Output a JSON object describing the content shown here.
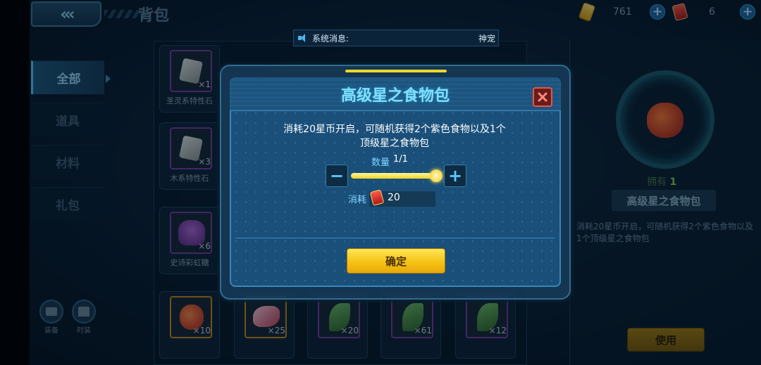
{
  "header": {
    "back_icon": "double-chevron-left",
    "title": "背包",
    "coins": "761",
    "gems": "6"
  },
  "sidebar": {
    "items": [
      {
        "label": "全部",
        "active": true
      },
      {
        "label": "道具",
        "active": false
      },
      {
        "label": "材料",
        "active": false
      },
      {
        "label": "礼包",
        "active": false
      }
    ],
    "equip_label": "装备",
    "fashion_label": "时装"
  },
  "system_message": {
    "label": "系统消息:",
    "text": "神宠"
  },
  "inventory": {
    "items": [
      {
        "name": "圣灵系特性石",
        "count": "×1"
      },
      {
        "name": "木系特性石",
        "count": "×3"
      },
      {
        "name": "史诗彩虹糖",
        "count": "×6"
      },
      {
        "name": "",
        "count": "×10"
      },
      {
        "name": "",
        "count": "×25"
      },
      {
        "name": "",
        "count": "×20"
      },
      {
        "name": "",
        "count": "×61"
      },
      {
        "name": "",
        "count": "×12"
      }
    ]
  },
  "detail": {
    "own_label": "拥有",
    "own_count": "1",
    "name": "高级星之食物包",
    "description": "消耗20星币开启，可随机获得2个紫色食物以及1个顶级星之食物包",
    "use_label": "使用"
  },
  "modal": {
    "title": "高级星之食物包",
    "description": "消耗20星币开启，可随机获得2个紫色食物以及1个顶级星之食物包",
    "quantity_label": "数量",
    "quantity_value": "1/1",
    "quantity_fraction": 1.0,
    "cost_label": "消耗",
    "cost_value": "20",
    "confirm_label": "确定",
    "minus_symbol": "−",
    "plus_symbol": "+"
  },
  "colors": {
    "accent": "#7fe3ff",
    "confirm": "#f6c618",
    "close": "#e1584a"
  }
}
